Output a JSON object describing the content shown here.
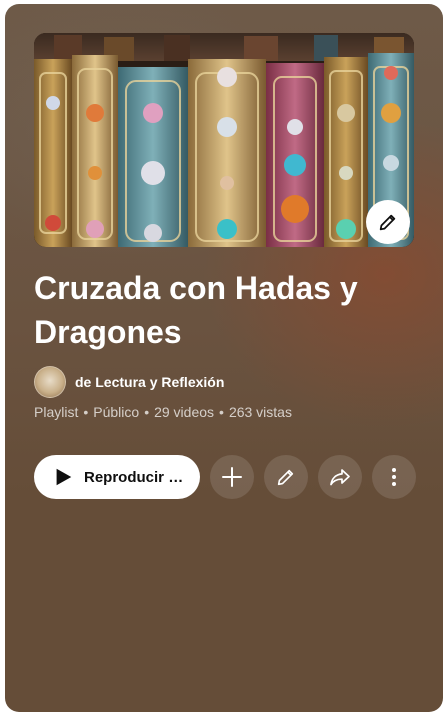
{
  "playlist": {
    "title": "Cruzada con Hadas y Dragones",
    "owner": "de Lectura y Reflexión",
    "meta": {
      "type": "Playlist",
      "separator": "•",
      "visibility": "Público",
      "videos": "29 videos",
      "views": "263 vistas"
    },
    "thumbnail_subject": "ornate jeweled book spines"
  },
  "actions": {
    "play_label": "Reproducir todo",
    "add_icon": "plus-icon",
    "edit_icon": "pencil-icon",
    "share_icon": "share-icon",
    "more_icon": "more-vertical-icon"
  },
  "colors": {
    "card_background": "#6a5340",
    "primary_text": "#ffffff",
    "secondary_text": "#d0c6bb",
    "play_button_bg": "#ffffff",
    "circle_button_bg": "#7f6b59"
  }
}
